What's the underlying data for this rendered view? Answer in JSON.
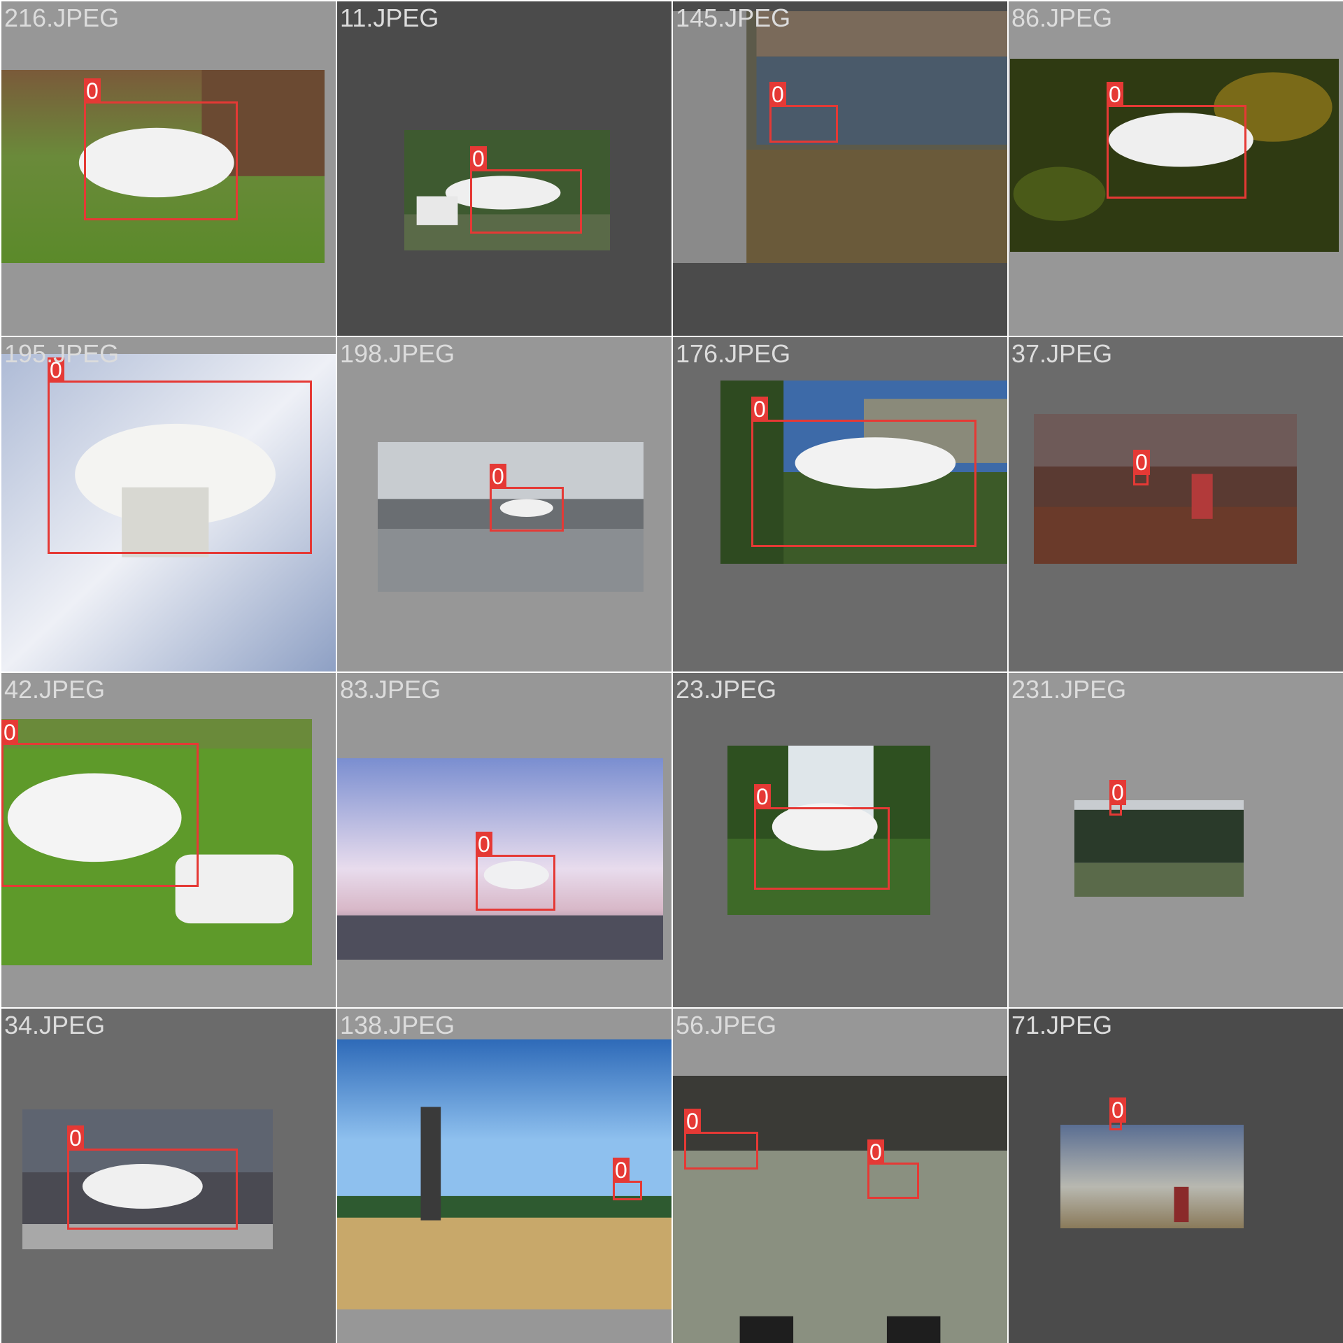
{
  "gallery": {
    "class_color": "#e53935",
    "tiles": [
      {
        "filename": "216.JPEG",
        "detections": [
          {
            "label": "0"
          }
        ]
      },
      {
        "filename": "11.JPEG",
        "detections": [
          {
            "label": "0"
          }
        ]
      },
      {
        "filename": "145.JPEG",
        "detections": [
          {
            "label": "0"
          }
        ]
      },
      {
        "filename": "86.JPEG",
        "detections": [
          {
            "label": "0"
          }
        ]
      },
      {
        "filename": "195.JPEG",
        "detections": [
          {
            "label": "0"
          }
        ]
      },
      {
        "filename": "198.JPEG",
        "detections": [
          {
            "label": "0"
          }
        ]
      },
      {
        "filename": "176.JPEG",
        "detections": [
          {
            "label": "0"
          }
        ]
      },
      {
        "filename": "37.JPEG",
        "detections": [
          {
            "label": "0"
          }
        ]
      },
      {
        "filename": "42.JPEG",
        "detections": [
          {
            "label": "0"
          }
        ]
      },
      {
        "filename": "83.JPEG",
        "detections": [
          {
            "label": "0"
          }
        ]
      },
      {
        "filename": "23.JPEG",
        "detections": [
          {
            "label": "0"
          }
        ]
      },
      {
        "filename": "231.JPEG",
        "detections": [
          {
            "label": "0"
          }
        ]
      },
      {
        "filename": "34.JPEG",
        "detections": [
          {
            "label": "0"
          }
        ]
      },
      {
        "filename": "138.JPEG",
        "detections": [
          {
            "label": "0"
          }
        ]
      },
      {
        "filename": "56.JPEG",
        "detections": [
          {
            "label": "0"
          },
          {
            "label": "0"
          }
        ]
      },
      {
        "filename": "71.JPEG",
        "detections": [
          {
            "label": "0"
          }
        ]
      }
    ]
  }
}
